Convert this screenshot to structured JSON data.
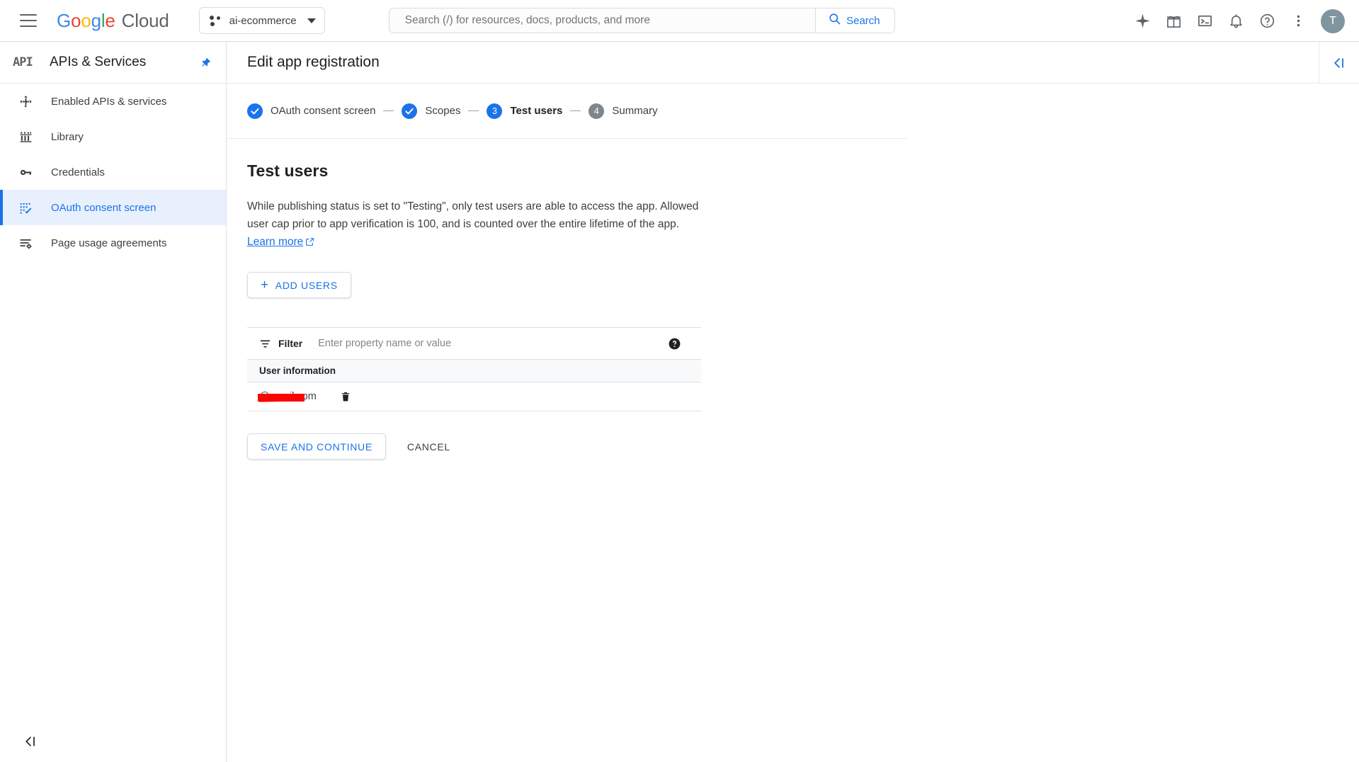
{
  "topbar": {
    "menu_icon": "hamburger-menu-icon",
    "brand": {
      "google": "Google",
      "cloud": "Cloud"
    },
    "project": {
      "name": "ai-ecommerce",
      "icon": "project-dots-icon",
      "caret": "chevron-down-icon"
    },
    "search": {
      "placeholder": "Search (/) for resources, docs, products, and more",
      "value": "",
      "button_label": "Search",
      "button_icon": "search-icon"
    },
    "icons": [
      {
        "name": "gemini-sparkle-icon",
        "title": "Gemini"
      },
      {
        "name": "gift-icon",
        "title": "Free trial credits"
      },
      {
        "name": "cloud-shell-terminal-icon",
        "title": "Activate Cloud Shell"
      },
      {
        "name": "notifications-bell-icon",
        "title": "Notifications"
      },
      {
        "name": "help-question-icon",
        "title": "Support"
      },
      {
        "name": "more-vert-icon",
        "title": "Settings and utilities"
      }
    ],
    "avatar": {
      "initial": "T"
    }
  },
  "sidebar": {
    "logo_text": "API",
    "title": "APIs & Services",
    "pin_icon": "pin-icon",
    "collapse_icon": "collapse-left-icon",
    "items": [
      {
        "label": "Enabled APIs & services",
        "icon": "enabled-apis-icon",
        "active": false
      },
      {
        "label": "Library",
        "icon": "library-icon",
        "active": false
      },
      {
        "label": "Credentials",
        "icon": "key-icon",
        "active": false
      },
      {
        "label": "OAuth consent screen",
        "icon": "oauth-consent-icon",
        "active": true
      },
      {
        "label": "Page usage agreements",
        "icon": "page-usage-agreements-icon",
        "active": false
      }
    ]
  },
  "page": {
    "title": "Edit app registration",
    "rail_toggle_icon": "collapse-right-panel-icon"
  },
  "stepper": {
    "steps": [
      {
        "badge": "check",
        "label": "OAuth consent screen",
        "state": "done"
      },
      {
        "badge": "check",
        "label": "Scopes",
        "state": "done"
      },
      {
        "badge": "3",
        "label": "Test users",
        "state": "current"
      },
      {
        "badge": "4",
        "label": "Summary",
        "state": "todo"
      }
    ]
  },
  "main": {
    "section_title": "Test users",
    "description_part1": "While publishing status is set to \"Testing\", only test users are able to access the app. Allowed user cap prior to app verification is 100, and is counted over the entire lifetime of the app. ",
    "learn_more": "Learn more",
    "learn_more_icon": "external-link-icon",
    "add_users_button": "ADD USERS",
    "add_users_icon": "plus-icon"
  },
  "table": {
    "filter_label": "Filter",
    "filter_icon": "filter-icon",
    "filter_placeholder": "Enter property name or value",
    "filter_value": "",
    "help_icon": "help-filled-icon",
    "column_header": "User information",
    "rows": [
      {
        "email_suffix": "@gmail.com",
        "redacted": true,
        "delete_icon": "trash-icon"
      }
    ]
  },
  "actions": {
    "save_label": "SAVE AND CONTINUE",
    "cancel_label": "CANCEL"
  },
  "colors": {
    "accent_blue": "#1a73e8",
    "active_bg": "#e8f0fe",
    "border": "#dadce0",
    "text": "#3c4043",
    "step_todo": "#80868b",
    "redaction_red": "#fb0404"
  }
}
